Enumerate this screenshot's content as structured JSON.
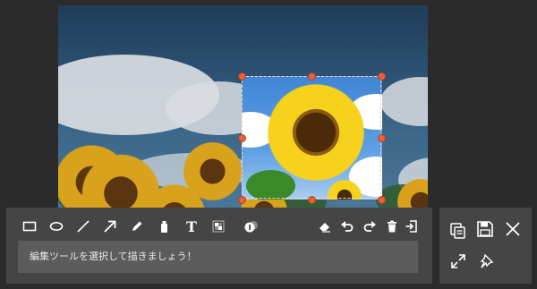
{
  "colors": {
    "background": "#2b2b2b",
    "toolbar": "#454545",
    "message_box": "#5c5c5c",
    "handle": "#e8603a",
    "icon": "#ffffff"
  },
  "image": {
    "subject": "sunflowers",
    "selection_handles": 8
  },
  "toolbar": {
    "tools": [
      {
        "name": "rectangle-icon"
      },
      {
        "name": "ellipse-icon"
      },
      {
        "name": "line-icon"
      },
      {
        "name": "arrow-icon"
      },
      {
        "name": "pencil-icon"
      },
      {
        "name": "marker-icon"
      },
      {
        "name": "text-tool",
        "label": "T"
      },
      {
        "name": "mosaic-icon"
      },
      {
        "name": "number-stamp-icon"
      }
    ],
    "actions": [
      {
        "name": "eraser-icon"
      },
      {
        "name": "undo-icon"
      },
      {
        "name": "redo-icon"
      },
      {
        "name": "trash-icon"
      },
      {
        "name": "exit-icon"
      }
    ],
    "message": "編集ツールを選択して描きましょう！"
  },
  "panel": {
    "icons": [
      "copy-icon",
      "save-icon",
      "close-icon",
      "expand-icon",
      "pin-icon"
    ]
  }
}
